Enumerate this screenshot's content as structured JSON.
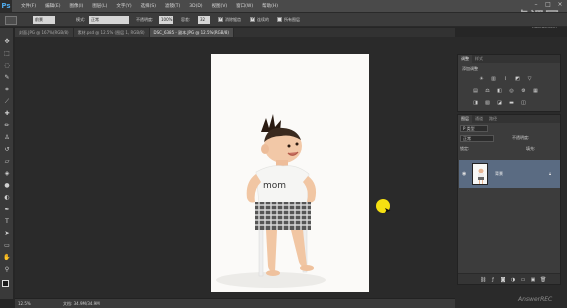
{
  "menubar": {
    "logo": "Ps",
    "items": [
      "文件(F)",
      "编辑(E)",
      "图像(I)",
      "图层(L)",
      "文字(Y)",
      "选择(S)",
      "滤镜(T)",
      "3D(D)",
      "视图(V)",
      "窗口(W)",
      "帮助(H)"
    ]
  },
  "options": {
    "mode_label": "模式:",
    "mode_value": "正常",
    "opacity_label": "不透明度:",
    "opacity_value": "100%",
    "flow_label": "容差:",
    "flow_value": "32",
    "check1": "消除锯齿",
    "check2": "连续的",
    "check3": "所有图层",
    "tool_value": "前景"
  },
  "tabs": [
    "封面.JPG @ 167%(RGB/8)",
    "素材.psd @ 12.5% (图层 1, RGB/8)",
    "DSC_6385 - 副本.JPG @ 12.5%(RGB/8)"
  ],
  "status": {
    "zoom": "12.5%",
    "doc": "文档: 34.9M/34.9M"
  },
  "watermark": {
    "brand": "虎课网",
    "sub": "huke88.com",
    "bottom": "AnswerREC"
  },
  "adjustments": {
    "tab_active": "调整",
    "tab2": "样式",
    "title": "添加调整"
  },
  "layers": {
    "tab_active": "图层",
    "tab2": "通道",
    "tab3": "路径",
    "kind_label": "P 类型",
    "blend_mode": "正常",
    "opacity_label": "不透明度:",
    "lock_label": "锁定:",
    "fill_label": "填充:",
    "layer_name": "背景"
  },
  "colors": {
    "accent": "#5a6b82",
    "cursor": "#f5e012",
    "ps_blue": "#4fa8e8"
  }
}
